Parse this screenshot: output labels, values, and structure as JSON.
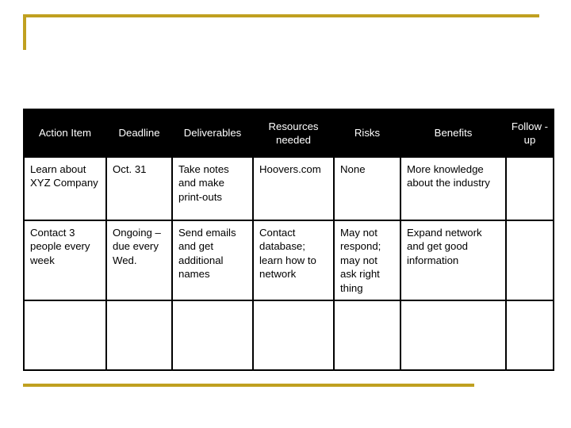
{
  "slide": {
    "background_color": "#FFFFFF",
    "accent_color": "#C0A020",
    "header_background_color": "#000000",
    "header_text_color": "#FFFFFF",
    "border_color": "#000000"
  },
  "table": {
    "headers": [
      "Action Item",
      "Deadline",
      "Deliverables",
      "Resources needed",
      "Risks",
      "Benefits",
      "Follow -up"
    ],
    "rows": [
      [
        "Learn about XYZ Company",
        "Oct. 31",
        "Take notes and make print-outs",
        "Hoovers.com",
        "None",
        "More knowledge about the industry",
        ""
      ],
      [
        "Contact 3 people every week",
        "Ongoing – due every Wed.",
        "Send emails and get additional names",
        "Contact database; learn how to network",
        "May not respond; may not ask right thing",
        "Expand network and get good information",
        ""
      ],
      [
        "",
        "",
        "",
        "",
        "",
        "",
        ""
      ]
    ]
  }
}
